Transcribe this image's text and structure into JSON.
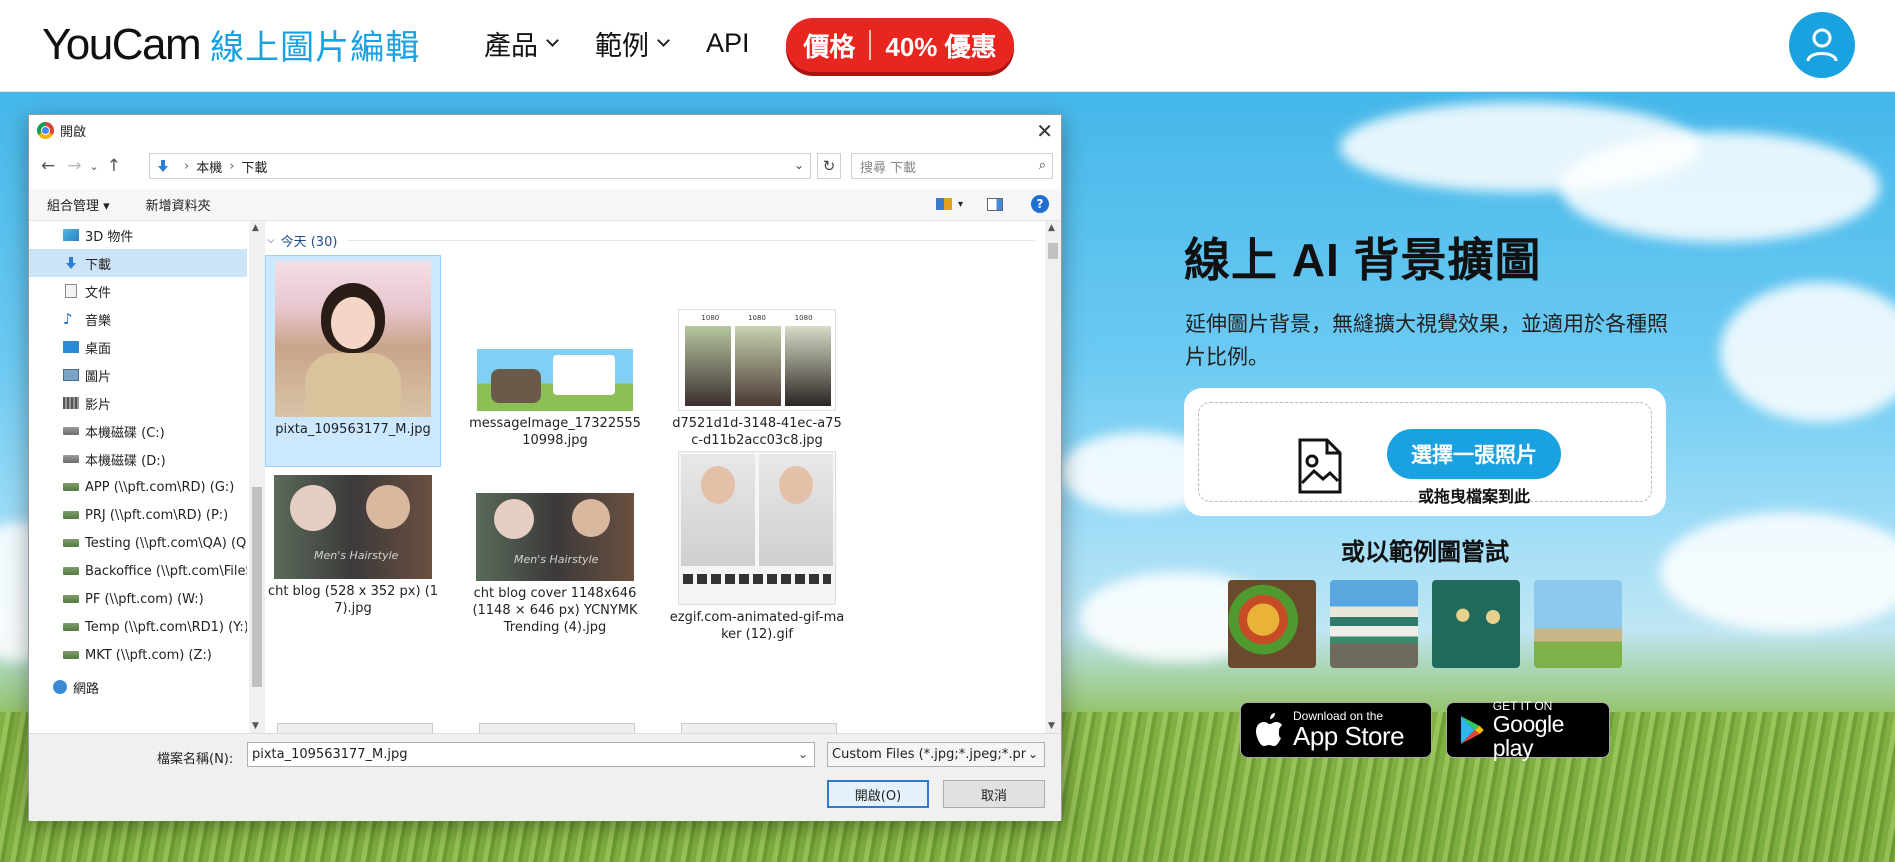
{
  "header": {
    "logo_main": "YouCam",
    "logo_sub": "線上圖片編輯",
    "nav": [
      {
        "label": "產品"
      },
      {
        "label": "範例"
      },
      {
        "label": "API"
      }
    ],
    "price_left": "價格",
    "price_right": "40% 優惠"
  },
  "dialog": {
    "title": "開啟",
    "close": "✕",
    "address": {
      "crumbs": [
        "本機",
        "下載"
      ]
    },
    "search_placeholder": "搜尋 下載",
    "toolbar": {
      "organize": "組合管理 ▾",
      "new_folder": "新增資料夾",
      "help": "?"
    },
    "nav_items": [
      {
        "label": "3D 物件",
        "icon": "3d-objects-icon"
      },
      {
        "label": "下載",
        "icon": "download-folder-icon",
        "selected": true
      },
      {
        "label": "文件",
        "icon": "documents-icon"
      },
      {
        "label": "音樂",
        "icon": "music-icon"
      },
      {
        "label": "桌面",
        "icon": "desktop-icon"
      },
      {
        "label": "圖片",
        "icon": "pictures-icon"
      },
      {
        "label": "影片",
        "icon": "videos-icon"
      },
      {
        "label": "本機磁碟 (C:)",
        "icon": "drive-icon"
      },
      {
        "label": "本機磁碟 (D:)",
        "icon": "drive-icon"
      },
      {
        "label": "APP (\\\\pft.com\\RD) (G:)",
        "icon": "network-drive-icon"
      },
      {
        "label": "PRJ (\\\\pft.com\\RD) (P:)",
        "icon": "network-drive-icon"
      },
      {
        "label": "Testing (\\\\pft.com\\QA) (Q:)",
        "icon": "network-drive-icon"
      },
      {
        "label": "Backoffice (\\\\pft.com\\FileSrv)",
        "icon": "network-drive-icon"
      },
      {
        "label": "PF (\\\\pft.com) (W:)",
        "icon": "network-drive-icon"
      },
      {
        "label": "Temp (\\\\pft.com\\RD1) (Y:)",
        "icon": "network-drive-icon"
      },
      {
        "label": "MKT (\\\\pft.com) (Z:)",
        "icon": "network-drive-icon"
      },
      {
        "label": "網路",
        "icon": "network-icon"
      }
    ],
    "group_label": "今天 (30)",
    "files": [
      {
        "name": "pixta_109563177_M.jpg",
        "selected": true
      },
      {
        "name": "messageImage_1732255510998.jpg"
      },
      {
        "name": "d7521d1d-3148-41ec-a75c-d11b2acc03c8.jpg"
      },
      {
        "name": "cht blog  (528 x 352 px) (17).jpg"
      },
      {
        "name": "cht blog cover 1148x646 (1148 × 646 px) YCNYMK Trending (4).jpg"
      },
      {
        "name": "ezgif.com-animated-gif-maker (12).gif"
      }
    ],
    "thumb_text": {
      "dims": "1080",
      "hair_style": "Men's Hairstyle"
    },
    "filename_label": "檔案名稱(N):",
    "filename_value": "pixta_109563177_M.jpg",
    "filter": "Custom Files (*.jpg;*.jpeg;*.pn",
    "open_button": "開啟(O)",
    "cancel_button": "取消"
  },
  "panel": {
    "title": "線上 AI 背景擴圖",
    "description": "延伸圖片背景，無縫擴大視覺效果，並適用於各種照片比例。",
    "upload_button": "選擇一張照片",
    "drop_text": "或拖曳檔案到此",
    "samples_title": "或以範例圖嘗試",
    "samples": [
      "tacos-sample",
      "castle-sample",
      "jewelry-sample",
      "beach-sample"
    ],
    "app_store": {
      "small": "Download on the",
      "big": "App Store"
    },
    "google_play": {
      "small": "GET IT ON",
      "big": "Google play"
    }
  },
  "colors": {
    "brand": "#1aa2e0",
    "price_red": "#e8251f",
    "select_blue": "#cce8ff"
  }
}
